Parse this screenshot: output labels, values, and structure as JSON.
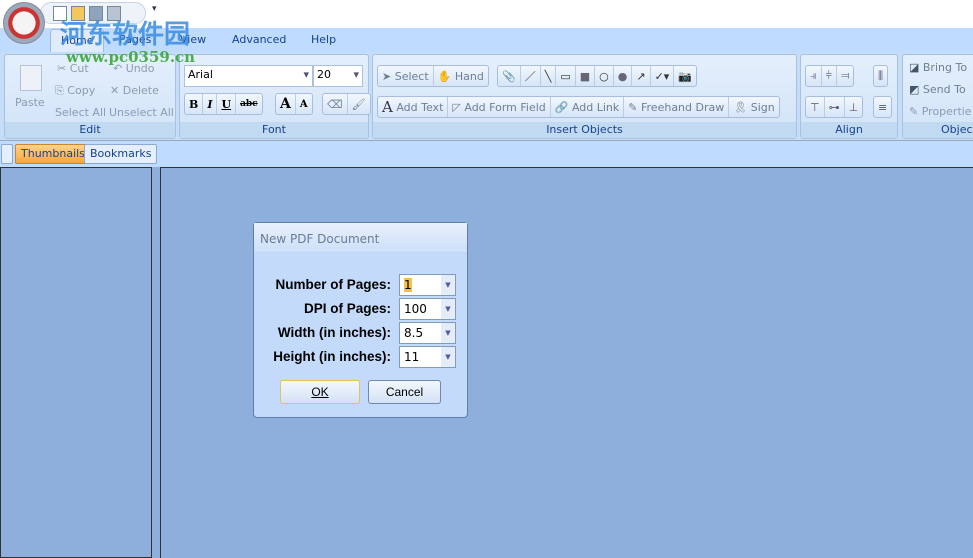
{
  "tabs": [
    "Home",
    "Pages",
    "View",
    "Advanced",
    "Help"
  ],
  "edit": {
    "paste": "Paste",
    "cut": "Cut",
    "copy": "Copy",
    "undo": "Undo",
    "delete": "Delete",
    "select_all": "Select All",
    "unselect_all": "Unselect All",
    "label": "Edit"
  },
  "font": {
    "name": "Arial",
    "size": "20",
    "bold": "B",
    "italic": "I",
    "underline": "U",
    "strike": "abc",
    "grow": "A",
    "shrink": "A",
    "label": "Font"
  },
  "insert": {
    "select": "Select",
    "hand": "Hand",
    "add_text": "Add Text",
    "add_form_field": "Add Form Field",
    "add_link": "Add Link",
    "freehand": "Freehand Draw",
    "sign": "Sign",
    "label": "Insert Objects"
  },
  "align": {
    "label": "Align"
  },
  "object": {
    "bring": "Bring To",
    "send": "Send To",
    "properties": "Propertie",
    "label": "Object"
  },
  "panel_tabs": [
    "Thumbnails",
    "Bookmarks"
  ],
  "dialog": {
    "title": "New PDF Document",
    "fields": [
      {
        "label": "Number of Pages:",
        "value": "1"
      },
      {
        "label": "DPI of Pages:",
        "value": "100"
      },
      {
        "label": "Width (in inches):",
        "value": "8.5"
      },
      {
        "label": "Height (in inches):",
        "value": "11"
      }
    ],
    "ok": "OK",
    "cancel": "Cancel"
  },
  "watermark": {
    "line1": "河东软件园",
    "line2": "www.pc0359.cn"
  }
}
